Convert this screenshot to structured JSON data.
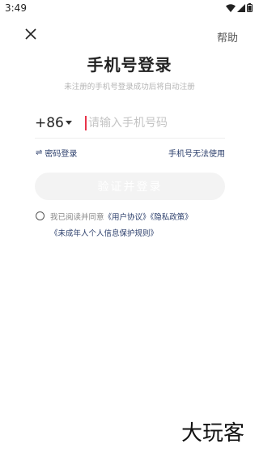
{
  "status_bar": {
    "time": "3:49"
  },
  "header": {
    "help_label": "帮助"
  },
  "title": "手机号登录",
  "subtitle": "未注册的手机号登录成功后将自动注册",
  "phone": {
    "country_code": "+86",
    "placeholder": "请输入手机号码",
    "value": ""
  },
  "links": {
    "swap_glyph": "⇌",
    "password_login": "密码登录",
    "phone_unavailable": "手机号无法使用"
  },
  "verify_button": "验证并登录",
  "agreement": {
    "prefix": "我已阅读并同意",
    "user_agreement": "《用户协议》",
    "privacy_policy": "《隐私政策》",
    "minor_rules": "《未成年人个人信息保护规则》"
  },
  "brand": "大玩客",
  "colors": {
    "link": "#2b3e6b",
    "cursor": "#e8334a",
    "button_bg": "#f3f3f3"
  }
}
